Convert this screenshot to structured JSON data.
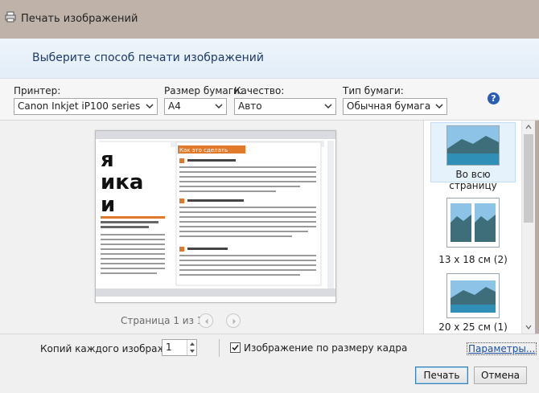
{
  "window": {
    "title": "Печать изображений",
    "icon": "printer-icon"
  },
  "header": {
    "text": "Выберите способ печати изображений"
  },
  "controls": {
    "printer": {
      "label": "Принтер:",
      "value": "Canon Inkjet iP100 series"
    },
    "paper_size": {
      "label": "Размер бумаги:",
      "value": "A4"
    },
    "quality": {
      "label": "Качество:",
      "value": "Авто"
    },
    "paper_type": {
      "label": "Тип бумаги:",
      "value": "Обычная бумага"
    },
    "help_icon": "help-icon"
  },
  "preview": {
    "page_label": "Страница 1 из 1",
    "doc_lines": [
      "я",
      "ика",
      "и",
      "Как это сделать"
    ]
  },
  "layouts": [
    {
      "label": "Во всю страницу",
      "selected": true
    },
    {
      "label": "13 x 18 см (2)",
      "selected": false
    },
    {
      "label": "20 x 25 см (1)",
      "selected": false
    }
  ],
  "bottom": {
    "copies_label": "Копий каждого изображения:",
    "copies_value": "1",
    "fit_label": "Изображение по размеру кадра",
    "fit_checked": true,
    "options_link": "Параметры...",
    "print_button": "Печать",
    "cancel_button": "Отмена"
  },
  "colors": {
    "accent": "#1f3b66",
    "link": "#1c4ea0",
    "help": "#2a5db3"
  }
}
